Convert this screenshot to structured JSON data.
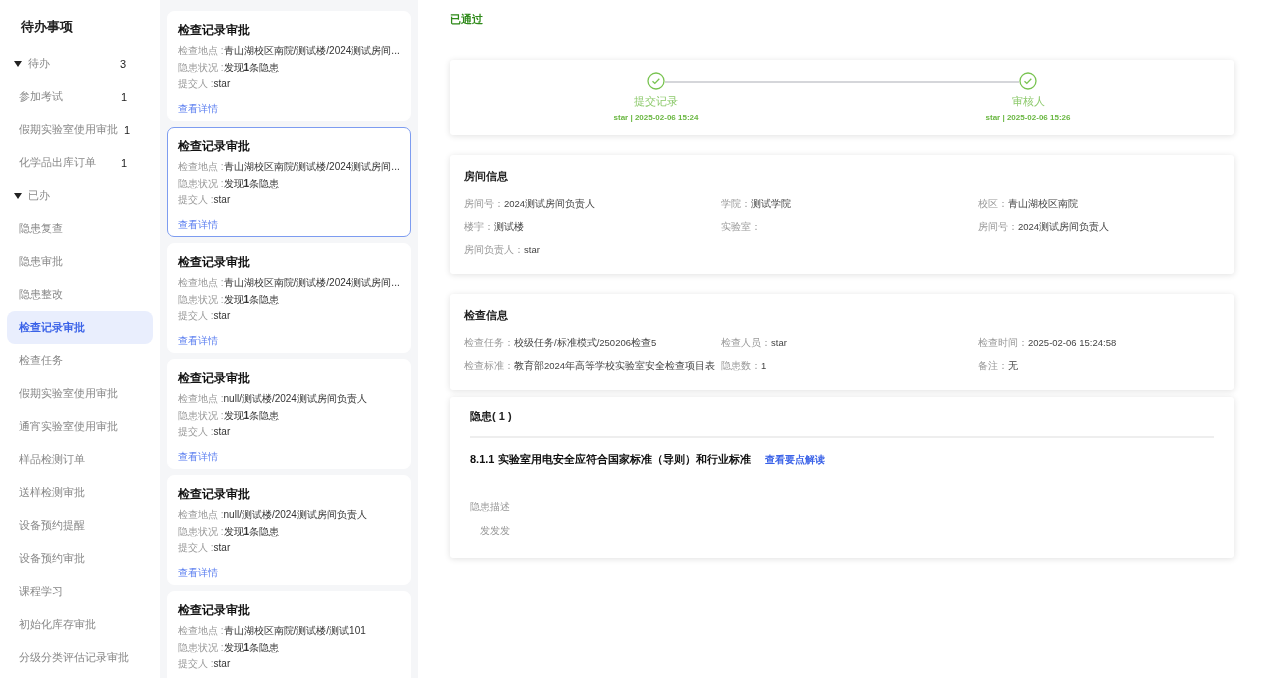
{
  "sidebar": {
    "title": "待办事项",
    "groups": [
      {
        "label": "待办",
        "count": "3",
        "expanded": true,
        "items": [
          {
            "label": "参加考试",
            "count": "1",
            "selected": false
          },
          {
            "label": "假期实验室使用审批",
            "count": "1",
            "selected": false
          },
          {
            "label": "化学品出库订单",
            "count": "1",
            "selected": false
          }
        ]
      },
      {
        "label": "已办",
        "expanded": true,
        "items": [
          {
            "label": "隐患复查",
            "selected": false
          },
          {
            "label": "隐患审批",
            "selected": false
          },
          {
            "label": "隐患整改",
            "selected": false
          },
          {
            "label": "检查记录审批",
            "selected": true
          },
          {
            "label": "检查任务",
            "selected": false
          },
          {
            "label": "假期实验室使用审批",
            "selected": false
          },
          {
            "label": "通宵实验室使用审批",
            "selected": false
          },
          {
            "label": "样品检测订单",
            "selected": false
          },
          {
            "label": "送样检测审批",
            "selected": false
          },
          {
            "label": "设备预约提醒",
            "selected": false
          },
          {
            "label": "设备预约审批",
            "selected": false
          },
          {
            "label": "课程学习",
            "selected": false
          },
          {
            "label": "初始化库存审批",
            "selected": false
          },
          {
            "label": "分级分类评估记录审批",
            "selected": false
          }
        ]
      }
    ]
  },
  "cards": [
    {
      "title": "检查记录审批",
      "selected": false,
      "fields": [
        {
          "label": "检查地点 :",
          "value": "青山湖校区南院/测试楼/2024测试房间..."
        },
        {
          "label": "隐患状况 :",
          "value": "发现**1**条隐患"
        },
        {
          "label": "提交人 :",
          "value": "star"
        }
      ],
      "link": "查看详情"
    },
    {
      "title": "检查记录审批",
      "selected": true,
      "fields": [
        {
          "label": "检查地点 :",
          "value": "青山湖校区南院/测试楼/2024测试房间..."
        },
        {
          "label": "隐患状况 :",
          "value": "发现**1**条隐患"
        },
        {
          "label": "提交人 :",
          "value": "star"
        }
      ],
      "link": "查看详情"
    },
    {
      "title": "检查记录审批",
      "selected": false,
      "fields": [
        {
          "label": "检查地点 :",
          "value": "青山湖校区南院/测试楼/2024测试房间..."
        },
        {
          "label": "隐患状况 :",
          "value": "发现**1**条隐患"
        },
        {
          "label": "提交人 :",
          "value": "star"
        }
      ],
      "link": "查看详情"
    },
    {
      "title": "检查记录审批",
      "selected": false,
      "fields": [
        {
          "label": "检查地点 :",
          "value": "null/测试楼/2024测试房间负责人"
        },
        {
          "label": "隐患状况 :",
          "value": "发现**1**条隐患"
        },
        {
          "label": "提交人 :",
          "value": "star"
        }
      ],
      "link": "查看详情"
    },
    {
      "title": "检查记录审批",
      "selected": false,
      "fields": [
        {
          "label": "检查地点 :",
          "value": "null/测试楼/2024测试房间负责人"
        },
        {
          "label": "隐患状况 :",
          "value": "发现**1**条隐患"
        },
        {
          "label": "提交人 :",
          "value": "star"
        }
      ],
      "link": "查看详情"
    },
    {
      "title": "检查记录审批",
      "selected": false,
      "fields": [
        {
          "label": "检查地点 :",
          "value": "青山湖校区南院/测试楼/测试101"
        },
        {
          "label": "隐患状况 :",
          "value": "发现**1**条隐患"
        },
        {
          "label": "提交人 :",
          "value": "star"
        }
      ]
    }
  ],
  "status": "已通过",
  "steps": [
    {
      "title": "提交记录",
      "detail": "star | 2025-02-06 15:24",
      "done": true
    },
    {
      "title": "审核人",
      "detail": "star | 2025-02-06 15:26",
      "done": true
    }
  ],
  "room_info": {
    "title": "房间信息",
    "fields": [
      {
        "label": "房间号：",
        "value": "2024测试房间负责人"
      },
      {
        "label": "学院：",
        "value": "测试学院"
      },
      {
        "label": "校区：",
        "value": "青山湖校区南院"
      },
      {
        "label": "楼宇：",
        "value": "测试楼"
      },
      {
        "label": "实验室："
      },
      {
        "label": "房间号：",
        "value": "2024测试房间负责人"
      },
      {
        "label": "房间负责人：",
        "value": "star"
      }
    ]
  },
  "inspection_info": {
    "title": "检查信息",
    "fields": [
      {
        "label": "检查任务：",
        "value": "校级任务/标准模式/250206检查5"
      },
      {
        "label": "检查人员：",
        "value": "star"
      },
      {
        "label": "检查时间：",
        "value": "2025-02-06 15:24:58"
      },
      {
        "label": "检查标准：",
        "value": "教育部2024年高等学校实验室安全检查项目表"
      },
      {
        "label": "隐患数：",
        "value": "1"
      },
      {
        "label": "备注：",
        "value": "无"
      }
    ]
  },
  "hazards": {
    "title": "隐患( 1 )",
    "items": [
      {
        "name": "8.1.1 实验室用电安全应符合国家标准（导则）和行业标准",
        "link": "查看要点解读",
        "description_label": "隐患描述",
        "description": "发发发"
      }
    ]
  }
}
